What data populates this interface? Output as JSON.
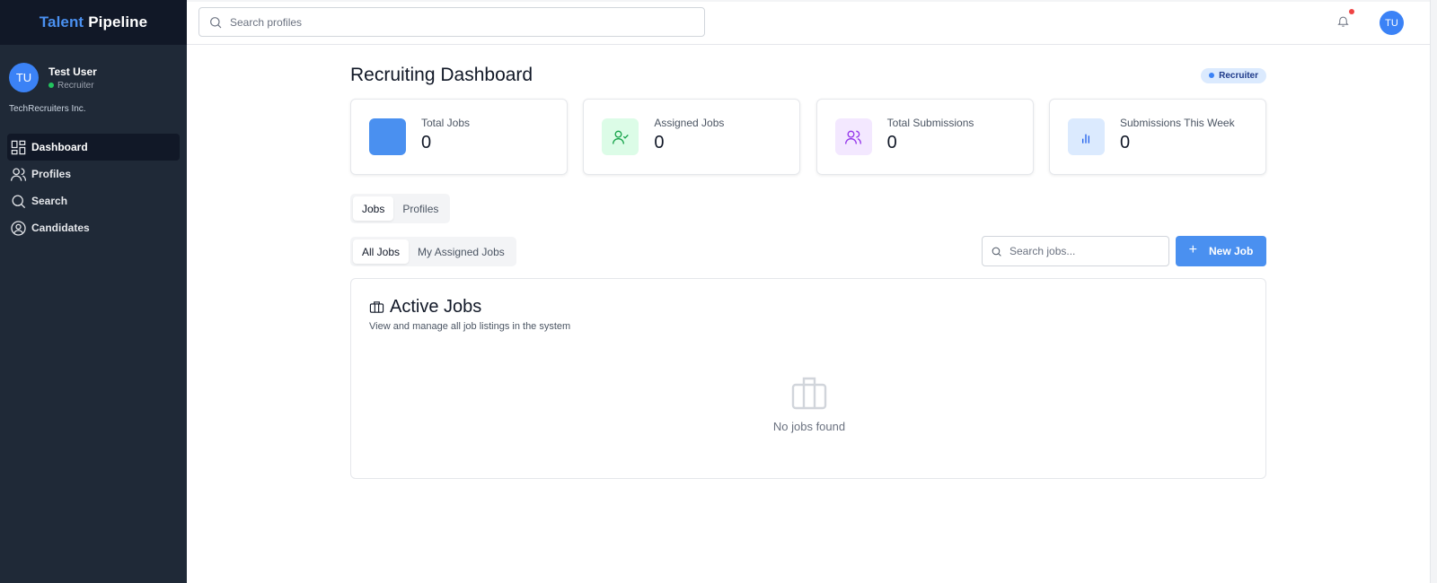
{
  "brand": {
    "part1": "Talent",
    "part2": "Pipeline"
  },
  "user": {
    "initials": "TU",
    "name": "Test User",
    "role": "Recruiter",
    "company": "TechRecruiters Inc."
  },
  "nav": {
    "items": [
      {
        "label": "Dashboard",
        "icon": "dashboard-icon",
        "active": true
      },
      {
        "label": "Profiles",
        "icon": "users-icon"
      },
      {
        "label": "Search",
        "icon": "search-icon"
      },
      {
        "label": "Candidates",
        "icon": "user-circle-icon"
      }
    ]
  },
  "topbar": {
    "search_placeholder": "Search profiles",
    "avatar_initials": "TU"
  },
  "page": {
    "title": "Recruiting Dashboard",
    "role_badge": "Recruiter"
  },
  "stats": [
    {
      "label": "Total Jobs",
      "value": "0",
      "icon": "square-icon",
      "color": "#4a90f0"
    },
    {
      "label": "Assigned Jobs",
      "value": "0",
      "icon": "user-check-icon",
      "color": "#16a34a"
    },
    {
      "label": "Total Submissions",
      "value": "0",
      "icon": "users-icon",
      "color": "#9333ea"
    },
    {
      "label": "Submissions This Week",
      "value": "0",
      "icon": "bar-chart-icon",
      "color": "#2563eb"
    }
  ],
  "tabs": {
    "main": [
      "Jobs",
      "Profiles"
    ],
    "sub": [
      "All Jobs",
      "My Assigned Jobs"
    ]
  },
  "jobs": {
    "search_placeholder": "Search jobs...",
    "new_button": "New Job",
    "card_title": "Active Jobs",
    "card_subtitle": "View and manage all job listings in the system",
    "empty_text": "No jobs found"
  },
  "colors": {
    "sidebar": "#1f2937",
    "brand_header": "#111827",
    "accent": "#4a90f0",
    "notification": "#ef4444",
    "online": "#22c55e"
  }
}
